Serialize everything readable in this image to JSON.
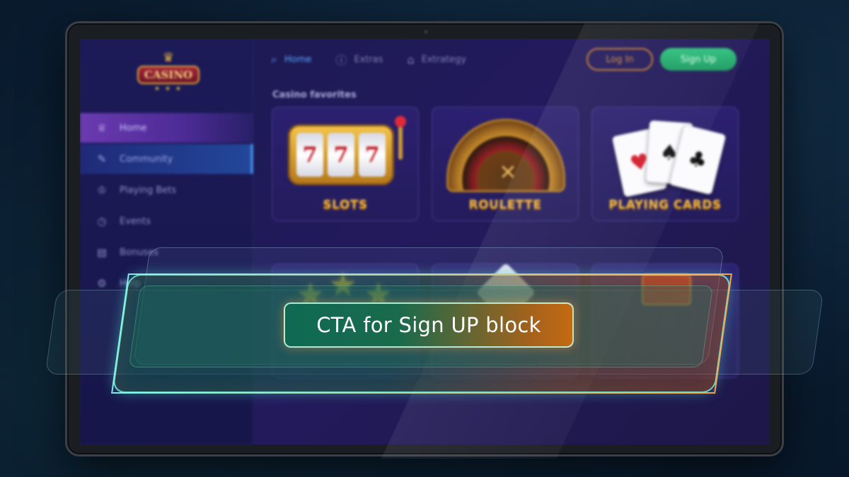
{
  "screen": {
    "logo": {
      "crown": "♛",
      "text": "CASINO",
      "stars": "★ ★ ★"
    },
    "sidebar": {
      "items": [
        {
          "icon": "♕",
          "label": "Home"
        },
        {
          "icon": "✎",
          "label": "Community"
        },
        {
          "icon": "♔",
          "label": "Playing Bets"
        },
        {
          "icon": "◷",
          "label": "Events"
        },
        {
          "icon": "▤",
          "label": "Bonuses"
        },
        {
          "icon": "⚙",
          "label": "Help"
        }
      ]
    },
    "topnav": {
      "items": [
        {
          "icon": "⌕",
          "label": "Home"
        },
        {
          "icon": "ⓘ",
          "label": "Extras"
        },
        {
          "icon": "⌂",
          "label": "Extrategy"
        }
      ],
      "login_label": "Log In",
      "signup_label": "Sign Up"
    },
    "section_title": "Casino favorites",
    "cards": [
      {
        "label": "SLOTS",
        "reels": [
          "7",
          "7",
          "7"
        ]
      },
      {
        "label": "ROULETTE"
      },
      {
        "label": "PLAYING CARDS",
        "suits": [
          "♥",
          "♠",
          "♣"
        ]
      }
    ],
    "row2_stars": [
      "★",
      "★",
      "★"
    ]
  },
  "cta": {
    "label": "CTA for Sign UP block"
  },
  "colors": {
    "accent_green": "#2ec27e",
    "accent_orange": "#c97d2f",
    "cta_glow": "#78f0dc"
  }
}
